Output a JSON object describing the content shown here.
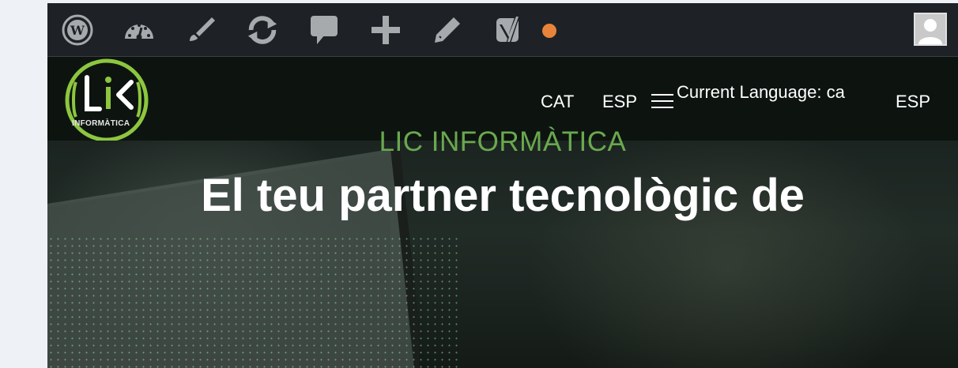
{
  "adminbar": {
    "icons": [
      "wordpress-icon",
      "dashboard-icon",
      "customize-icon",
      "updates-icon",
      "comments-icon",
      "new-content-icon",
      "edit-icon",
      "yoast-icon"
    ],
    "status_dot_color": "#e8833a",
    "avatar_icon": "user-avatar-icon"
  },
  "header": {
    "logo_text": "INFORMÀTICA",
    "nav": {
      "cat": "CAT",
      "esp": "ESP",
      "current_language": "Current Language: ca",
      "esp_secondary": "ESP"
    }
  },
  "hero": {
    "kicker": "LIC INFORMÀTICA",
    "title": "El teu partner tecnològic de"
  },
  "colors": {
    "accent_green": "#6aa84f",
    "logo_green": "#8dc63f",
    "adminbar_bg": "#1e2227"
  }
}
